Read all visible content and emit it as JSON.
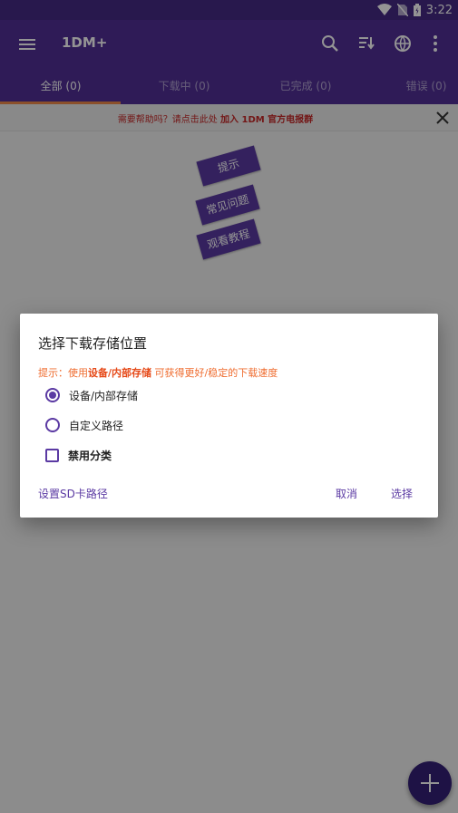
{
  "status_bar": {
    "time": "3:22"
  },
  "app_bar": {
    "title": "1DM+",
    "icons": [
      "menu-icon",
      "search-icon",
      "sort-icon",
      "browser-icon",
      "more-vert-icon"
    ]
  },
  "tabs": [
    {
      "label": "全部 (0)",
      "active": true
    },
    {
      "label": "下载中 (0)",
      "active": false
    },
    {
      "label": "已完成 (0)",
      "active": false
    },
    {
      "label": "错误 (0)",
      "active": false
    }
  ],
  "banner": {
    "text_prefix": "需要帮助吗？请点击此处",
    "text_strong": "加入 1DM 官方电报群"
  },
  "help_buttons": [
    "提示",
    "常见问题",
    "观看教程"
  ],
  "dialog": {
    "title": "选择下载存储位置",
    "hint_prefix": "提示：使用",
    "hint_strong": "设备/内部存储",
    "hint_suffix": "可获得更好/稳定的下载速度",
    "options": [
      {
        "label": "设备/内部存储",
        "type": "radio",
        "selected": true
      },
      {
        "label": "自定义路径",
        "type": "radio",
        "selected": false
      },
      {
        "label": "禁用分类",
        "type": "checkbox",
        "checked": false
      }
    ],
    "buttons": {
      "sd_path": "设置SD卡路径",
      "cancel": "取消",
      "select": "选择"
    }
  },
  "colors": {
    "primary": "#512f97",
    "accent": "#f08a4b",
    "banner_text": "#c62828",
    "hint": "#ef6c2f"
  }
}
